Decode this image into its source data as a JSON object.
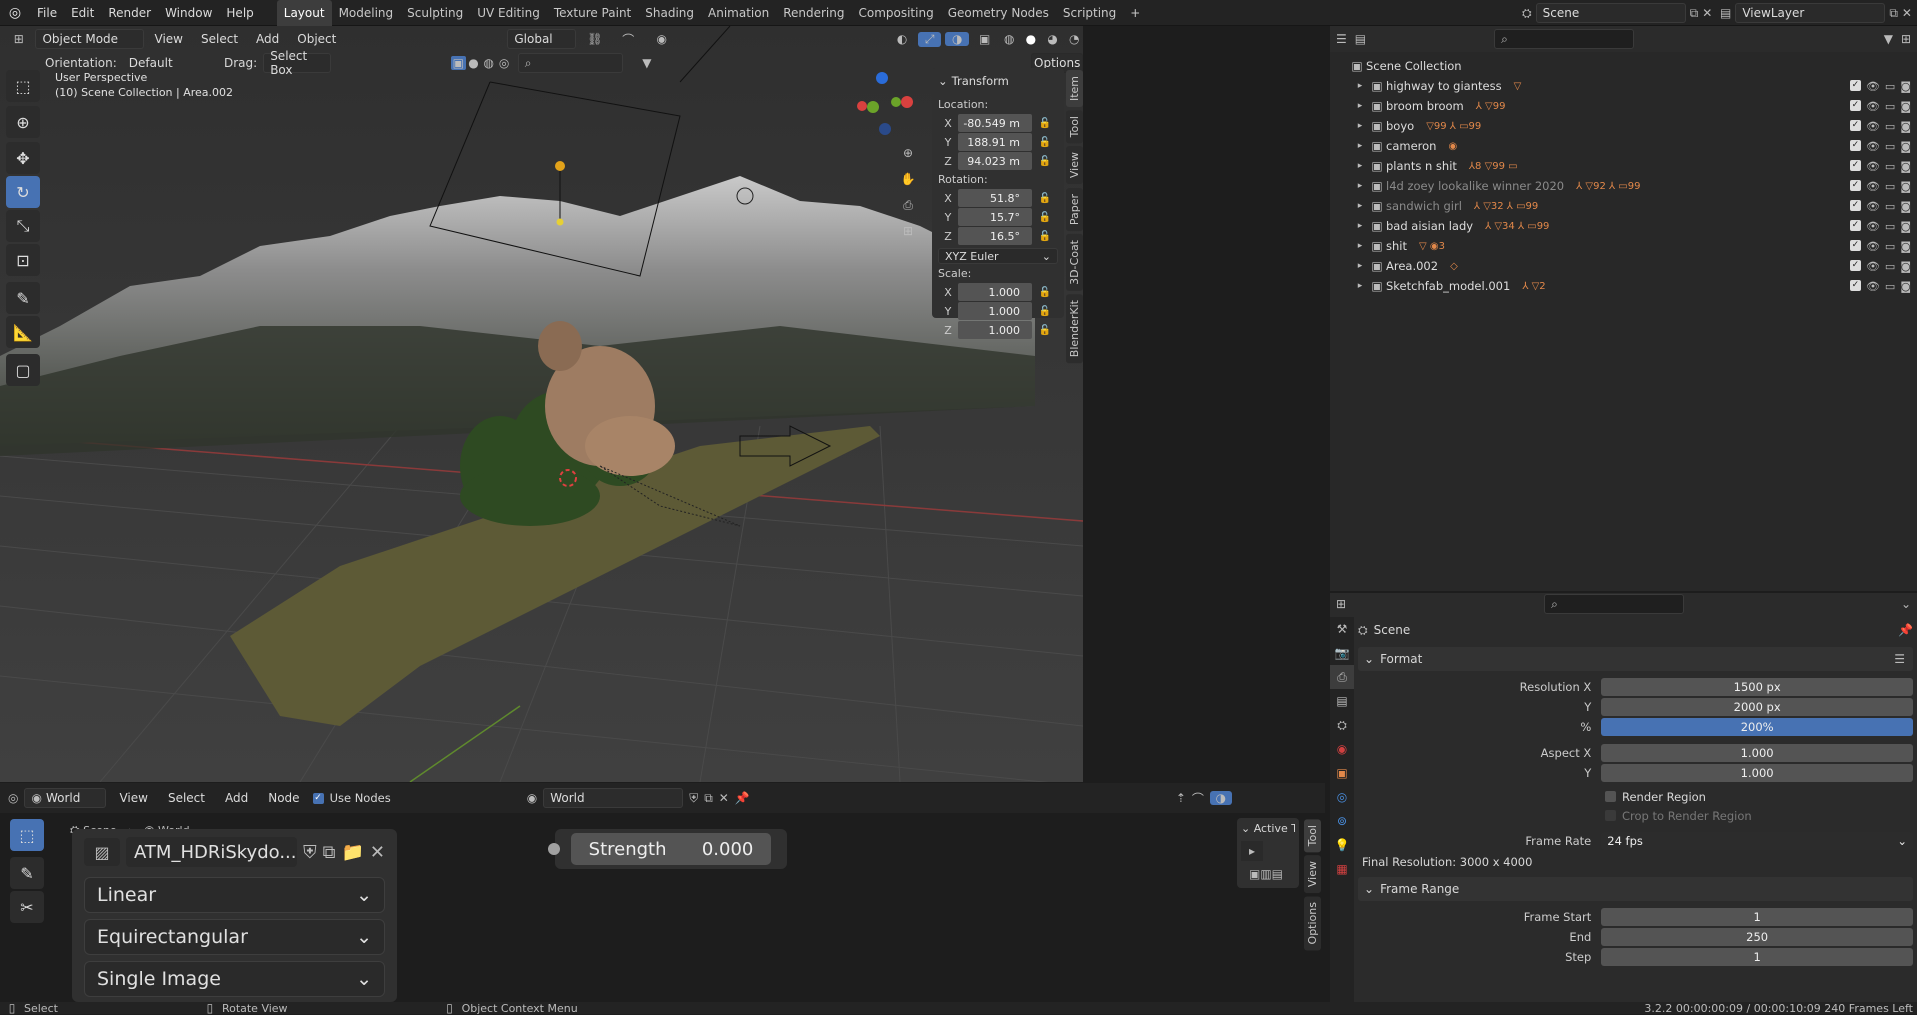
{
  "menubar": {
    "items": [
      "File",
      "Edit",
      "Render",
      "Window",
      "Help"
    ],
    "workspaces": [
      "Layout",
      "Modeling",
      "Sculpting",
      "UV Editing",
      "Texture Paint",
      "Shading",
      "Animation",
      "Rendering",
      "Compositing",
      "Geometry Nodes",
      "Scripting"
    ],
    "active_workspace": "Layout",
    "add_tab": "+",
    "scene": "Scene",
    "view_layer": "ViewLayer"
  },
  "viewport": {
    "mode": "Object Mode",
    "menus": [
      "View",
      "Select",
      "Add",
      "Object"
    ],
    "transform_orientation": "Global",
    "orientation_label": "Orientation:",
    "orientation_value": "Default",
    "drag_label": "Drag:",
    "drag_value": "Select Box",
    "options": "Options",
    "overlay_title": "User Perspective",
    "overlay_sub": "(10) Scene Collection | Area.002",
    "side_tabs": [
      "Item",
      "Tool",
      "View",
      "Paper",
      "3D-Coat",
      "BlenderKit"
    ]
  },
  "transform": {
    "title": "Transform",
    "location_label": "Location:",
    "location": [
      {
        "axis": "X",
        "value": "-80.549 m"
      },
      {
        "axis": "Y",
        "value": "188.91 m"
      },
      {
        "axis": "Z",
        "value": "94.023 m"
      }
    ],
    "rotation_label": "Rotation:",
    "rotation": [
      {
        "axis": "X",
        "value": "51.8°"
      },
      {
        "axis": "Y",
        "value": "15.7°"
      },
      {
        "axis": "Z",
        "value": "16.5°"
      }
    ],
    "rotation_mode": "XYZ Euler",
    "scale_label": "Scale:",
    "scale": [
      {
        "axis": "X",
        "value": "1.000"
      },
      {
        "axis": "Y",
        "value": "1.000"
      },
      {
        "axis": "Z",
        "value": "1.000"
      }
    ]
  },
  "outliner": {
    "root": "Scene Collection",
    "items": [
      {
        "label": "highway to giantess",
        "badges": "▽",
        "dim": false
      },
      {
        "label": "broom broom",
        "badges": "⅄ ▽99",
        "dim": false
      },
      {
        "label": "boyo",
        "badges": "▽99 ⅄ ▭99",
        "dim": false
      },
      {
        "label": "cameron",
        "badges": "◉",
        "dim": false
      },
      {
        "label": "plants n shit",
        "badges": "⅄8 ▽99 ▭",
        "dim": false
      },
      {
        "label": "l4d zoey lookalike winner 2020",
        "badges": "⅄ ▽92 ⅄ ▭99",
        "dim": true
      },
      {
        "label": "sandwich girl",
        "badges": "⅄ ▽32 ⅄ ▭99",
        "dim": true
      },
      {
        "label": "bad aisian lady",
        "badges": "⅄ ▽34 ⅄ ▭99",
        "dim": false
      },
      {
        "label": "shit",
        "badges": "▽ ◉3",
        "dim": false
      },
      {
        "label": "Area.002",
        "badges": "◇",
        "dim": false
      },
      {
        "label": "Sketchfab_model.001",
        "badges": "⅄ ▽2",
        "dim": false
      }
    ]
  },
  "properties": {
    "context": "Scene",
    "format_title": "Format",
    "rows": [
      {
        "label": "Resolution X",
        "value": "1500 px"
      },
      {
        "label": "Y",
        "value": "2000 px"
      },
      {
        "label": "%",
        "value": "200%",
        "selected": true
      }
    ],
    "aspect": [
      {
        "label": "Aspect X",
        "value": "1.000"
      },
      {
        "label": "Y",
        "value": "1.000"
      }
    ],
    "render_region": "Render Region",
    "crop": "Crop to Render Region",
    "frame_rate_label": "Frame Rate",
    "frame_rate": "24 fps",
    "final_res": "Final Resolution: 3000 x 4000",
    "frame_range_title": "Frame Range",
    "frame_range": [
      {
        "label": "Frame Start",
        "value": "1"
      },
      {
        "label": "End",
        "value": "250"
      },
      {
        "label": "Step",
        "value": "1"
      }
    ]
  },
  "shader": {
    "world_dropdown": "World",
    "menus": [
      "View",
      "Select",
      "Add",
      "Node"
    ],
    "use_nodes": "Use Nodes",
    "world_field": "World",
    "breadcrumb_scene": "Scene",
    "breadcrumb_world": "World",
    "image_name": "ATM_HDRiSkydo...",
    "interp": "Linear",
    "projection": "Equirectangular",
    "source": "Single Image",
    "strength_label": "Strength",
    "strength_value": "0.000",
    "active_tool": "Active T",
    "side_tabs": [
      "Tool",
      "View",
      "Options"
    ]
  },
  "statusbar": {
    "select": "Select",
    "rotate": "Rotate View",
    "context": "Object Context Menu",
    "info": "3.2.2   00:00:00:09 / 00:00:10:09   240 Frames Left"
  }
}
